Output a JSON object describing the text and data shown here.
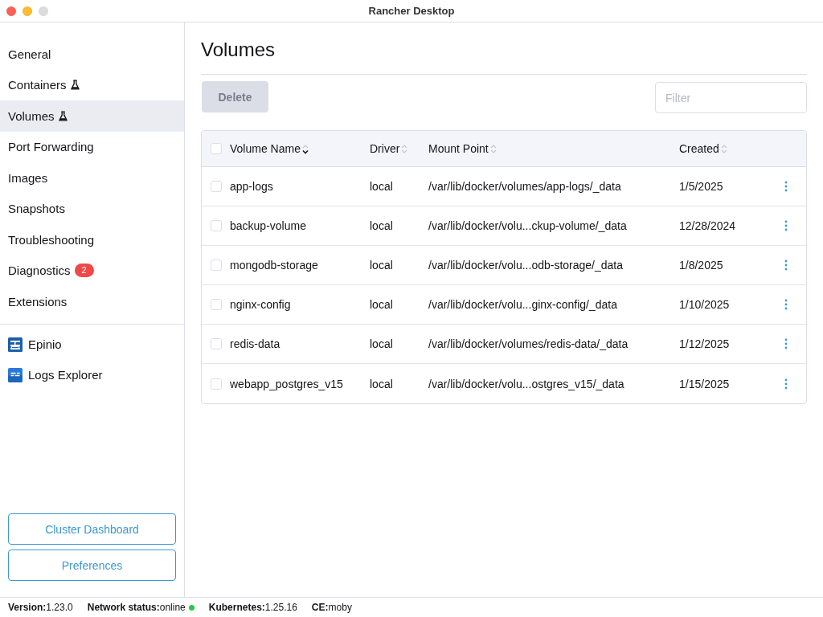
{
  "window": {
    "title": "Rancher Desktop",
    "maximize_enabled": false
  },
  "sidebar": {
    "items": [
      {
        "label": "General",
        "selected": false,
        "experimental": false
      },
      {
        "label": "Containers",
        "selected": false,
        "experimental": true
      },
      {
        "label": "Volumes",
        "selected": true,
        "experimental": true
      },
      {
        "label": "Port Forwarding",
        "selected": false,
        "experimental": false
      },
      {
        "label": "Images",
        "selected": false,
        "experimental": false
      },
      {
        "label": "Snapshots",
        "selected": false,
        "experimental": false
      },
      {
        "label": "Troubleshooting",
        "selected": false,
        "experimental": false
      },
      {
        "label": "Diagnostics",
        "selected": false,
        "experimental": false,
        "badge": "2"
      },
      {
        "label": "Extensions",
        "selected": false,
        "experimental": false
      }
    ],
    "extensions": [
      {
        "label": "Epinio",
        "selected": false
      },
      {
        "label": "Logs Explorer",
        "selected": false
      }
    ],
    "buttons": [
      "Cluster Dashboard",
      "Preferences"
    ]
  },
  "page": {
    "title": "Volumes",
    "delete_button": {
      "label": "Delete",
      "disabled": true
    },
    "filter": {
      "placeholder": "Filter"
    }
  },
  "table": {
    "select_all": {
      "checked": false
    },
    "columns": [
      {
        "label": "Volume Name",
        "sorted": true
      },
      {
        "label": "Driver",
        "sorted": false
      },
      {
        "label": "Mount Point",
        "sorted": false
      },
      {
        "label": "Created",
        "sorted": false
      }
    ],
    "rows": [
      {
        "checked": false,
        "cells": [
          "app-logs",
          "local",
          "/var/lib/docker/volumes/app-logs/_data",
          "1/5/2025"
        ]
      },
      {
        "checked": false,
        "cells": [
          "backup-volume",
          "local",
          "/var/lib/docker/volu...ckup-volume/_data",
          "12/28/2024"
        ]
      },
      {
        "checked": false,
        "cells": [
          "mongodb-storage",
          "local",
          "/var/lib/docker/volu...odb-storage/_data",
          "1/8/2025"
        ]
      },
      {
        "checked": false,
        "cells": [
          "nginx-config",
          "local",
          "/var/lib/docker/volu...ginx-config/_data",
          "1/10/2025"
        ]
      },
      {
        "checked": false,
        "cells": [
          "redis-data",
          "local",
          "/var/lib/docker/volumes/redis-data/_data",
          "1/12/2025"
        ]
      },
      {
        "checked": false,
        "cells": [
          "webapp_postgres_v15",
          "local",
          "/var/lib/docker/volu...ostgres_v15/_data",
          "1/15/2025"
        ]
      }
    ]
  },
  "status_bar": [
    {
      "label": "Version:",
      "value": "1.23.0"
    },
    {
      "label": "Network status:",
      "value": "online",
      "color": "#28c840"
    },
    {
      "label": "Kubernetes:",
      "value": "1.25.16"
    },
    {
      "label": "CE:",
      "value": "moby"
    }
  ]
}
